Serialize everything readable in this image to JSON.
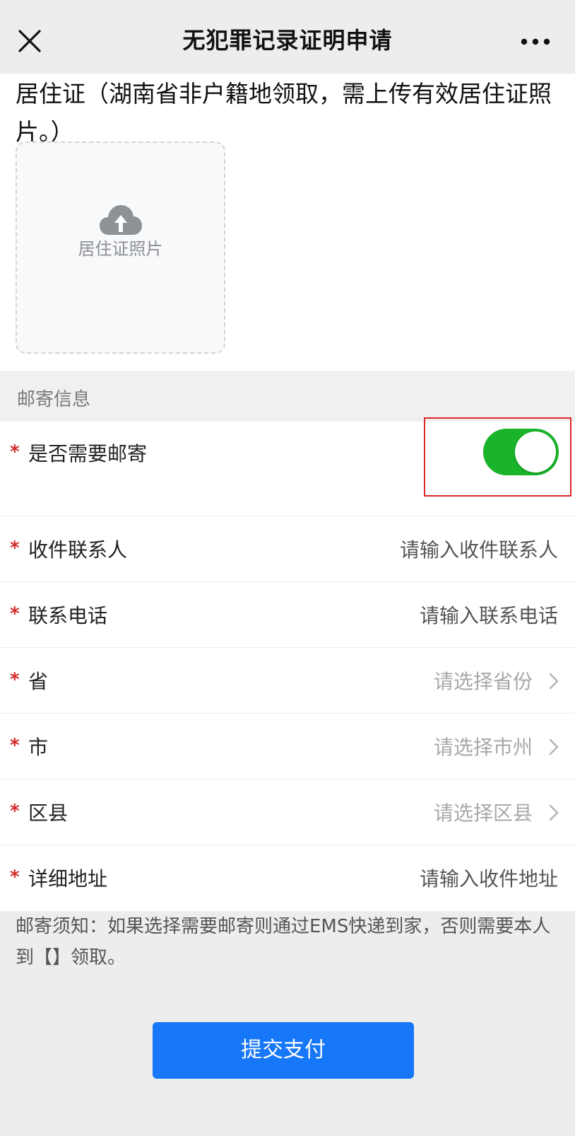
{
  "header": {
    "title": "无犯罪记录证明申请",
    "close_icon": "close-icon",
    "more_icon": "more-icon"
  },
  "upload": {
    "description": "居住证（湖南省非户籍地领取，需上传有效居住证照片。）",
    "box_label": "居住证照片",
    "icon": "cloud-upload-icon"
  },
  "mailing_section": {
    "title": "邮寄信息"
  },
  "form": {
    "required_mark": "*",
    "need_mail": {
      "label": "是否需要邮寄",
      "toggle_on": true
    },
    "recipient": {
      "label": "收件联系人",
      "placeholder": "请输入收件联系人"
    },
    "phone": {
      "label": "联系电话",
      "placeholder": "请输入联系电话"
    },
    "province": {
      "label": "省",
      "placeholder": "请选择省份"
    },
    "city": {
      "label": "市",
      "placeholder": "请选择市州"
    },
    "district": {
      "label": "区县",
      "placeholder": "请选择区县"
    },
    "address": {
      "label": "详细地址",
      "placeholder": "请输入收件地址"
    }
  },
  "notice": "邮寄须知：如果选择需要邮寄则通过EMS快递到家，否则需要本人到【】领取。",
  "submit_label": "提交支付",
  "colors": {
    "toggle_on": "#19b42a",
    "submit_button": "#1677f8",
    "required_mark": "#d32a2a",
    "highlight_border": "#e02727"
  }
}
